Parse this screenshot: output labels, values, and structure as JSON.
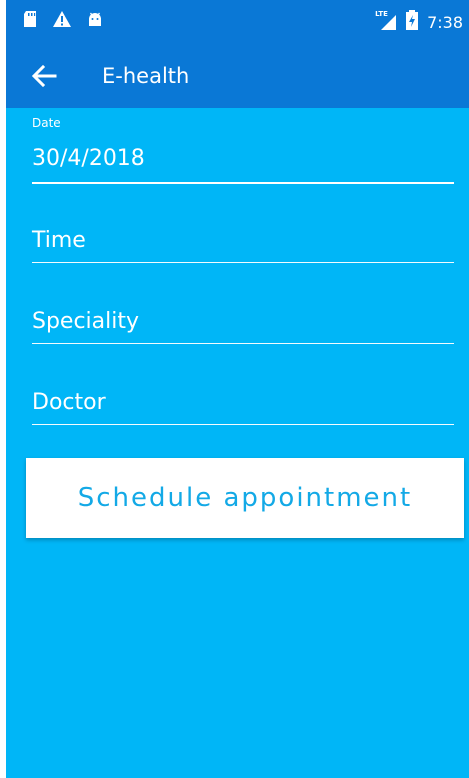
{
  "status_bar": {
    "left_icons": [
      "sd-card-icon",
      "warning-icon",
      "android-icon"
    ],
    "network": "LTE",
    "time": "7:38"
  },
  "app_bar": {
    "title": "E-health"
  },
  "form": {
    "date": {
      "label": "Date",
      "value": "30/4/2018"
    },
    "time": {
      "placeholder": "Time"
    },
    "speciality": {
      "placeholder": "Speciality"
    },
    "doctor": {
      "placeholder": "Doctor"
    }
  },
  "actions": {
    "schedule_label": "Schedule appointment"
  },
  "colors": {
    "app_bar": "#0a78d6",
    "background": "#00b6f7",
    "button_text": "#13a9e6"
  }
}
